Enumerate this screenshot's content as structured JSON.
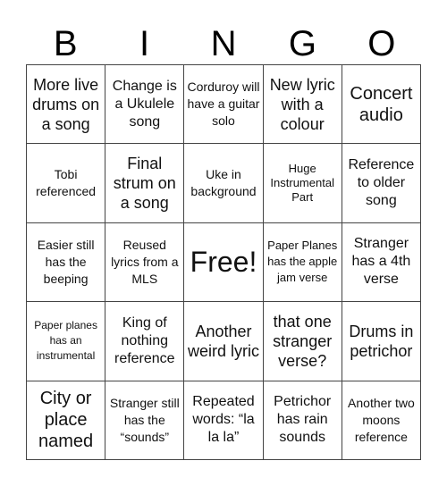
{
  "header": {
    "letters": [
      "B",
      "I",
      "N",
      "G",
      "O"
    ]
  },
  "cells": [
    [
      "More live drums on a song",
      "Change is a Ukulele song",
      "Corduroy will have a guitar solo",
      "New lyric with a colour",
      "Concert audio"
    ],
    [
      "Tobi referenced",
      "Final strum on a song",
      "Uke in background",
      "Huge Instrumental Part",
      "Reference to older song"
    ],
    [
      "Easier still has the beeping",
      "Reused lyrics from a MLS",
      "Free!",
      "Paper Planes has the apple jam verse",
      "Stranger has a 4th verse"
    ],
    [
      "Paper planes has an instrumental",
      "King of nothing reference",
      "Another weird lyric",
      "that one stranger verse?",
      "Drums in petrichor"
    ],
    [
      "City or place named",
      "Stranger still has the “sounds”",
      "Repeated words: “la la la”",
      "Petrichor has rain sounds",
      "Another two moons reference"
    ]
  ],
  "free_space": {
    "row": 2,
    "col": 2,
    "label": "Free!"
  }
}
